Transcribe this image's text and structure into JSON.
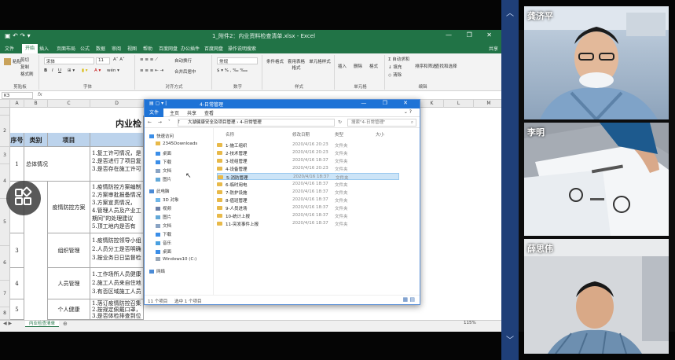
{
  "excel": {
    "filename": "1_附件2：内业资料检查清单.xlsx - Excel",
    "tabs": [
      "文件",
      "开始",
      "插入",
      "页面布局",
      "公式",
      "数据",
      "审阅",
      "视图",
      "帮助",
      "百度网盘",
      "办公插件",
      "百度网盘",
      "操作说明搜索"
    ],
    "share": "共享",
    "ribbon": {
      "paste": "粘贴",
      "cut": "剪切",
      "copy": "复制",
      "format_painter": "格式刷",
      "clipboard_label": "剪贴板",
      "font_name": "宋体",
      "font_size": "11",
      "font_label": "字体",
      "wrap": "自动换行",
      "merge": "合并后居中",
      "align_label": "对齐方式",
      "number_format": "常规",
      "number_label": "数字",
      "cond_format": "条件格式",
      "table_format": "套用表格格式",
      "cell_style": "单元格样式",
      "style_label": "样式",
      "insert": "插入",
      "delete": "删除",
      "format": "格式",
      "cells_label": "单元格",
      "autosum": "自动求和",
      "fill": "填充",
      "clear": "清除",
      "sort": "排序和筛选",
      "find": "查找和选择",
      "edit_label": "编辑"
    },
    "cell_ref": "K3",
    "fx": "fx",
    "columns": [
      "A",
      "B",
      "C",
      "D",
      "E",
      "F",
      "G",
      "H",
      "I",
      "J",
      "K",
      "L",
      "M"
    ],
    "sheet_title": "内业检",
    "headers": [
      "序号",
      "类别",
      "项目"
    ],
    "rows": [
      {
        "num": "1",
        "cat": "总体情况",
        "item": "",
        "text": [
          "1.复工许可情况，是",
          "2.是否进行了项目复",
          "3.是否存在施工许可"
        ]
      },
      {
        "num": "2",
        "cat": "",
        "item": "疫情防控方案",
        "text": [
          "1.疫情防控方案编制",
          "2.方案审批报备情况",
          "3.方案宣贯情况，",
          "4.管理人员及产业工",
          "期间\"的处理建议",
          "5.顶工地内是否有"
        ]
      },
      {
        "num": "3",
        "cat": "",
        "item": "组织管理",
        "text": [
          "1.疫情防控领导小组",
          "2.人员分工是否明确",
          "3.按业务日日监督检"
        ]
      },
      {
        "num": "4",
        "cat": "",
        "item": "人员管理",
        "text": [
          "1.工作场所人员健康",
          "2.施工人员来自住地",
          "3.有否区域施工人员"
        ]
      },
      {
        "num": "5",
        "cat": "",
        "item": "个人健康",
        "text": [
          "1.落订疫情防控召集",
          "2.按规定佩戴口罩，",
          "3.是否体检排查到位"
        ]
      }
    ],
    "sheet_tab": "内业检查清单",
    "zoom": "115%"
  },
  "explorer": {
    "title": "4-日常管理",
    "tabs": [
      "文件",
      "主页",
      "共享",
      "查看"
    ],
    "path": [
      "大湖健康安全及项目管理",
      "4-日常管理"
    ],
    "search_placeholder": "搜索\"4-日常管理\"",
    "quick_access": "快速访问",
    "nav": [
      "2345Downloads",
      "桌面",
      "下载",
      "文档",
      "图片"
    ],
    "this_pc": "此电脑",
    "pc_items": [
      "3D 对象",
      "视频",
      "图片",
      "文档",
      "下载",
      "音乐",
      "桌面",
      "Windows10 (C:)"
    ],
    "network": "网络",
    "col_name": "名称",
    "col_date": "修改日期",
    "col_type": "类型",
    "col_size": "大小",
    "files": [
      {
        "name": "1-施工组织",
        "date": "2020/4/16 20:23",
        "type": "文件夹"
      },
      {
        "name": "2-技术管理",
        "date": "2020/4/16 20:23",
        "type": "文件夹"
      },
      {
        "name": "3-班组管理",
        "date": "2020/4/16 18:37",
        "type": "文件夹"
      },
      {
        "name": "4-设备管理",
        "date": "2020/4/16 20:23",
        "type": "文件夹"
      },
      {
        "name": "5-消防管理",
        "date": "2020/4/16 18:37",
        "type": "文件夹"
      },
      {
        "name": "6-临时用电",
        "date": "2020/4/16 18:37",
        "type": "文件夹"
      },
      {
        "name": "7-防护设施",
        "date": "2020/4/16 18:37",
        "type": "文件夹"
      },
      {
        "name": "8-值班管理",
        "date": "2020/4/16 18:37",
        "type": "文件夹"
      },
      {
        "name": "9-人员进场",
        "date": "2020/4/16 18:37",
        "type": "文件夹"
      },
      {
        "name": "10-统计上报",
        "date": "2020/4/16 18:37",
        "type": "文件夹"
      },
      {
        "name": "11-突发事件上报",
        "date": "2020/4/16 18:37",
        "type": "文件夹"
      }
    ],
    "selected_index": 4,
    "status_count": "11 个项目",
    "status_selected": "选中 1 个项目"
  },
  "participants": [
    "龚济平",
    "李明",
    "薛思伟"
  ]
}
